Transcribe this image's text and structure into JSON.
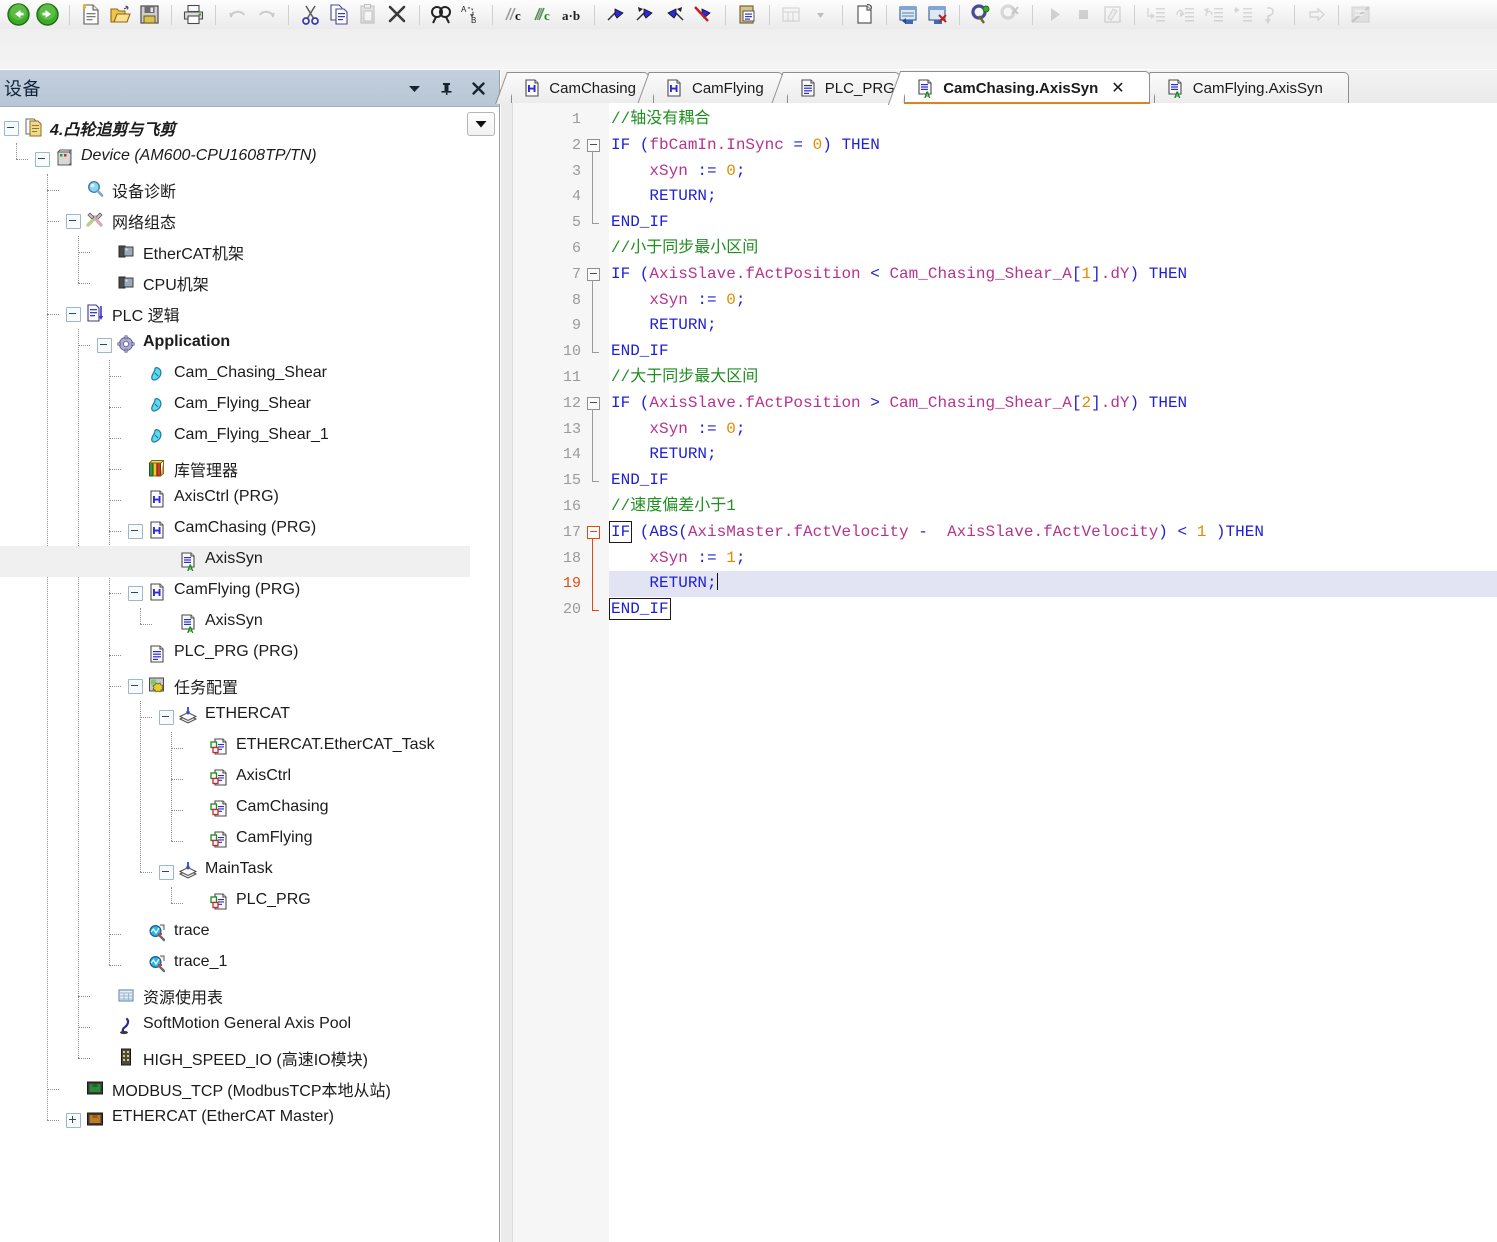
{
  "toolbar": {
    "groups": [
      {
        "items": [
          {
            "name": "back-icon",
            "label": "Back",
            "disabled": false
          },
          {
            "name": "forward-icon",
            "label": "Forward",
            "disabled": false
          }
        ]
      },
      {
        "items": [
          {
            "name": "new-file-icon",
            "label": "New",
            "disabled": false
          },
          {
            "name": "open-folder-icon",
            "label": "Open",
            "disabled": false
          },
          {
            "name": "save-icon",
            "label": "Save",
            "disabled": false
          }
        ]
      },
      {
        "items": [
          {
            "name": "print-icon",
            "label": "Print",
            "disabled": false
          }
        ]
      },
      {
        "items": [
          {
            "name": "undo-icon",
            "label": "Undo",
            "disabled": true
          },
          {
            "name": "redo-icon",
            "label": "Redo",
            "disabled": true
          }
        ]
      },
      {
        "items": [
          {
            "name": "cut-icon",
            "label": "Cut",
            "disabled": false
          },
          {
            "name": "copy-icon",
            "label": "Copy",
            "disabled": false
          },
          {
            "name": "paste-icon",
            "label": "Paste",
            "disabled": true
          },
          {
            "name": "delete-icon",
            "label": "Delete",
            "disabled": false
          }
        ]
      },
      {
        "items": [
          {
            "name": "find-icon",
            "label": "Find",
            "disabled": false
          },
          {
            "name": "replace-icon",
            "label": "Replace",
            "disabled": false
          }
        ]
      },
      {
        "items": [
          {
            "name": "comment-icon",
            "label": "Comment",
            "disabled": false
          },
          {
            "name": "uncomment-icon",
            "label": "Uncomment",
            "disabled": false
          },
          {
            "name": "text-case-icon",
            "label": "Toggle case",
            "disabled": false
          }
        ]
      },
      {
        "items": [
          {
            "name": "bookmark-toggle-icon",
            "label": "Toggle bookmark",
            "disabled": false
          },
          {
            "name": "bookmark-next-icon",
            "label": "Next bookmark",
            "disabled": false
          },
          {
            "name": "bookmark-prev-icon",
            "label": "Previous bookmark",
            "disabled": false
          },
          {
            "name": "bookmark-clear-icon",
            "label": "Clear bookmarks",
            "disabled": false
          }
        ]
      },
      {
        "items": [
          {
            "name": "properties-icon",
            "label": "Properties",
            "disabled": false
          }
        ]
      },
      {
        "items": [
          {
            "name": "insert-table-icon",
            "label": "Insert",
            "disabled": true
          },
          {
            "name": "insert-table-dropdown-icon",
            "label": "Insert options",
            "disabled": true
          }
        ]
      },
      {
        "items": [
          {
            "name": "new-page-icon",
            "label": "New page",
            "disabled": false
          }
        ]
      },
      {
        "items": [
          {
            "name": "login-icon",
            "label": "Login",
            "disabled": false
          },
          {
            "name": "logout-icon",
            "label": "Logout",
            "disabled": false
          }
        ]
      },
      {
        "items": [
          {
            "name": "build-icon",
            "label": "Build",
            "disabled": false
          },
          {
            "name": "build-clean-icon",
            "label": "Clean",
            "disabled": true
          }
        ]
      },
      {
        "items": [
          {
            "name": "run-icon",
            "label": "Start",
            "disabled": true
          },
          {
            "name": "stop-icon",
            "label": "Stop",
            "disabled": true
          },
          {
            "name": "write-values-icon",
            "label": "Write values",
            "disabled": true
          }
        ]
      },
      {
        "items": [
          {
            "name": "step-into-icon",
            "label": "Step into",
            "disabled": true
          },
          {
            "name": "step-over-icon",
            "label": "Step over",
            "disabled": true
          },
          {
            "name": "step-out-icon",
            "label": "Step out",
            "disabled": true
          },
          {
            "name": "run-to-cursor-icon",
            "label": "Run to cursor",
            "disabled": true
          },
          {
            "name": "set-next-statement-icon",
            "label": "Set next statement",
            "disabled": true
          }
        ]
      },
      {
        "items": [
          {
            "name": "next-instruction-icon",
            "label": "Next instruction",
            "disabled": true
          }
        ]
      },
      {
        "items": [
          {
            "name": "flow-control-icon",
            "label": "Flow control",
            "disabled": true
          }
        ]
      }
    ]
  },
  "devices": {
    "title": "设备",
    "header_buttons": [
      {
        "name": "panel-menu-icon",
        "glyph": "▼"
      },
      {
        "name": "pin-icon",
        "glyph": "⊥"
      },
      {
        "name": "close-icon",
        "glyph": "✕"
      }
    ],
    "dropdown_glyph": "▼",
    "tree": [
      {
        "label": "4.凸轮追剪与飞剪",
        "icon": "project-icon",
        "indent": 0,
        "toggle": "minus",
        "style": "italic-bold"
      },
      {
        "label": "Device (AM600-CPU1608TP/TN)",
        "icon": "plc-device-icon",
        "indent": 1,
        "toggle": "minus",
        "style": "italic"
      },
      {
        "label": "设备诊断",
        "icon": "diagnostics-icon",
        "indent": 2,
        "toggle": "none",
        "style": ""
      },
      {
        "label": "网络组态",
        "icon": "network-config-icon",
        "indent": 2,
        "toggle": "minus",
        "style": ""
      },
      {
        "label": "EtherCAT机架",
        "icon": "rack-icon",
        "indent": 3,
        "toggle": "none",
        "style": ""
      },
      {
        "label": "CPU机架",
        "icon": "rack-icon",
        "indent": 3,
        "toggle": "none",
        "style": ""
      },
      {
        "label": "PLC 逻辑",
        "icon": "plc-logic-icon",
        "indent": 2,
        "toggle": "minus",
        "style": ""
      },
      {
        "label": "Application",
        "icon": "application-icon",
        "indent": 3,
        "toggle": "minus",
        "style": "bold"
      },
      {
        "label": "Cam_Chasing_Shear",
        "icon": "cam-icon",
        "indent": 4,
        "toggle": "none",
        "style": ""
      },
      {
        "label": "Cam_Flying_Shear",
        "icon": "cam-icon",
        "indent": 4,
        "toggle": "none",
        "style": ""
      },
      {
        "label": "Cam_Flying_Shear_1",
        "icon": "cam-icon",
        "indent": 4,
        "toggle": "none",
        "style": ""
      },
      {
        "label": "库管理器",
        "icon": "library-manager-icon",
        "indent": 4,
        "toggle": "none",
        "style": ""
      },
      {
        "label": "AxisCtrl (PRG)",
        "icon": "prg-icon",
        "indent": 4,
        "toggle": "none",
        "style": ""
      },
      {
        "label": "CamChasing (PRG)",
        "icon": "prg-icon",
        "indent": 4,
        "toggle": "minus",
        "style": ""
      },
      {
        "label": "AxisSyn",
        "icon": "action-st-icon",
        "indent": 5,
        "toggle": "none",
        "style": "",
        "selected": true
      },
      {
        "label": "CamFlying (PRG)",
        "icon": "prg-icon",
        "indent": 4,
        "toggle": "minus",
        "style": ""
      },
      {
        "label": "AxisSyn",
        "icon": "action-st-icon",
        "indent": 5,
        "toggle": "none",
        "style": ""
      },
      {
        "label": "PLC_PRG (PRG)",
        "icon": "pou-icon",
        "indent": 4,
        "toggle": "none",
        "style": ""
      },
      {
        "label": "任务配置",
        "icon": "task-config-icon",
        "indent": 4,
        "toggle": "minus",
        "style": ""
      },
      {
        "label": "ETHERCAT",
        "icon": "task-group-icon",
        "indent": 5,
        "toggle": "minus",
        "style": ""
      },
      {
        "label": "ETHERCAT.EtherCAT_Task",
        "icon": "task-call-icon",
        "indent": 6,
        "toggle": "none",
        "style": ""
      },
      {
        "label": "AxisCtrl",
        "icon": "task-call-icon",
        "indent": 6,
        "toggle": "none",
        "style": ""
      },
      {
        "label": "CamChasing",
        "icon": "task-call-icon",
        "indent": 6,
        "toggle": "none",
        "style": ""
      },
      {
        "label": "CamFlying",
        "icon": "task-call-icon",
        "indent": 6,
        "toggle": "none",
        "style": ""
      },
      {
        "label": "MainTask",
        "icon": "task-group-icon",
        "indent": 5,
        "toggle": "minus",
        "style": ""
      },
      {
        "label": "PLC_PRG",
        "icon": "task-call-icon",
        "indent": 6,
        "toggle": "none",
        "style": ""
      },
      {
        "label": "trace",
        "icon": "trace-icon",
        "indent": 4,
        "toggle": "none",
        "style": ""
      },
      {
        "label": "trace_1",
        "icon": "trace-icon",
        "indent": 4,
        "toggle": "none",
        "style": ""
      },
      {
        "label": "资源使用表",
        "icon": "resource-table-icon",
        "indent": 3,
        "toggle": "none",
        "style": ""
      },
      {
        "label": "SoftMotion General Axis Pool",
        "icon": "axis-pool-icon",
        "indent": 3,
        "toggle": "none",
        "style": ""
      },
      {
        "label": "HIGH_SPEED_IO (高速IO模块)",
        "icon": "high-speed-io-icon",
        "indent": 3,
        "toggle": "none",
        "style": ""
      },
      {
        "label": "MODBUS_TCP (ModbusTCP本地从站)",
        "icon": "modbus-tcp-icon",
        "indent": 2,
        "toggle": "none",
        "style": ""
      },
      {
        "label": "ETHERCAT (EtherCAT Master)",
        "icon": "ethercat-master-icon",
        "indent": 2,
        "toggle": "plus",
        "style": ""
      }
    ]
  },
  "editor": {
    "tabs": [
      {
        "label": "CamChasing",
        "icon": "prg-icon",
        "active": false,
        "closable": false
      },
      {
        "label": "CamFlying",
        "icon": "prg-icon",
        "active": false,
        "closable": false
      },
      {
        "label": "PLC_PRG",
        "icon": "pou-icon",
        "active": false,
        "closable": false
      },
      {
        "label": "CamChasing.AxisSyn",
        "icon": "action-st-icon",
        "active": true,
        "closable": true,
        "close_glyph": "✕"
      },
      {
        "label": "CamFlying.AxisSyn",
        "icon": "action-st-icon",
        "active": false,
        "closable": false
      }
    ],
    "accent_color": "#e08020",
    "current_line": 19,
    "cursor_after": "RETURN;",
    "lines": [
      {
        "n": 1,
        "fold": "none",
        "tokens": [
          {
            "t": "//轴没有耦合",
            "c": "c"
          }
        ]
      },
      {
        "n": 2,
        "fold": "start",
        "tokens": [
          {
            "t": "IF",
            "c": "k"
          },
          {
            "t": " (",
            "c": "p"
          },
          {
            "t": "fbCamIn.InSync",
            "c": "id"
          },
          {
            "t": " = ",
            "c": "p"
          },
          {
            "t": "0",
            "c": "n"
          },
          {
            "t": ") ",
            "c": "p"
          },
          {
            "t": "THEN",
            "c": "k"
          }
        ]
      },
      {
        "n": 3,
        "fold": "bar",
        "tokens": [
          {
            "t": "    ",
            "c": "p"
          },
          {
            "t": "xSyn",
            "c": "id"
          },
          {
            "t": " := ",
            "c": "p"
          },
          {
            "t": "0",
            "c": "n"
          },
          {
            "t": ";",
            "c": "p"
          }
        ]
      },
      {
        "n": 4,
        "fold": "bar",
        "tokens": [
          {
            "t": "    ",
            "c": "p"
          },
          {
            "t": "RETURN;",
            "c": "k"
          }
        ]
      },
      {
        "n": 5,
        "fold": "end",
        "tokens": [
          {
            "t": "END_IF",
            "c": "k"
          }
        ]
      },
      {
        "n": 6,
        "fold": "none",
        "tokens": [
          {
            "t": "//小于同步最小区间",
            "c": "c"
          }
        ]
      },
      {
        "n": 7,
        "fold": "start",
        "tokens": [
          {
            "t": "IF",
            "c": "k"
          },
          {
            "t": " (",
            "c": "p"
          },
          {
            "t": "AxisSlave.fActPosition",
            "c": "id"
          },
          {
            "t": " < ",
            "c": "p"
          },
          {
            "t": "Cam_Chasing_Shear_A",
            "c": "id"
          },
          {
            "t": "[",
            "c": "p"
          },
          {
            "t": "1",
            "c": "n"
          },
          {
            "t": "]",
            "c": "p"
          },
          {
            "t": ".dY",
            "c": "id"
          },
          {
            "t": ") ",
            "c": "p"
          },
          {
            "t": "THEN",
            "c": "k"
          }
        ]
      },
      {
        "n": 8,
        "fold": "bar",
        "tokens": [
          {
            "t": "    ",
            "c": "p"
          },
          {
            "t": "xSyn",
            "c": "id"
          },
          {
            "t": " := ",
            "c": "p"
          },
          {
            "t": "0",
            "c": "n"
          },
          {
            "t": ";",
            "c": "p"
          }
        ]
      },
      {
        "n": 9,
        "fold": "bar",
        "tokens": [
          {
            "t": "    ",
            "c": "p"
          },
          {
            "t": "RETURN;",
            "c": "k"
          }
        ]
      },
      {
        "n": 10,
        "fold": "end",
        "tokens": [
          {
            "t": "END_IF",
            "c": "k"
          }
        ]
      },
      {
        "n": 11,
        "fold": "none",
        "tokens": [
          {
            "t": "//大于同步最大区间",
            "c": "c"
          }
        ]
      },
      {
        "n": 12,
        "fold": "start",
        "tokens": [
          {
            "t": "IF",
            "c": "k"
          },
          {
            "t": " (",
            "c": "p"
          },
          {
            "t": "AxisSlave.fActPosition",
            "c": "id"
          },
          {
            "t": " > ",
            "c": "p"
          },
          {
            "t": "Cam_Chasing_Shear_A",
            "c": "id"
          },
          {
            "t": "[",
            "c": "p"
          },
          {
            "t": "2",
            "c": "n"
          },
          {
            "t": "]",
            "c": "p"
          },
          {
            "t": ".dY",
            "c": "id"
          },
          {
            "t": ") ",
            "c": "p"
          },
          {
            "t": "THEN",
            "c": "k"
          }
        ]
      },
      {
        "n": 13,
        "fold": "bar",
        "tokens": [
          {
            "t": "    ",
            "c": "p"
          },
          {
            "t": "xSyn",
            "c": "id"
          },
          {
            "t": " := ",
            "c": "p"
          },
          {
            "t": "0",
            "c": "n"
          },
          {
            "t": ";",
            "c": "p"
          }
        ]
      },
      {
        "n": 14,
        "fold": "bar",
        "tokens": [
          {
            "t": "    ",
            "c": "p"
          },
          {
            "t": "RETURN;",
            "c": "k"
          }
        ]
      },
      {
        "n": 15,
        "fold": "end",
        "tokens": [
          {
            "t": "END_IF",
            "c": "k"
          }
        ]
      },
      {
        "n": 16,
        "fold": "none",
        "tokens": [
          {
            "t": "//速度偏差小于1",
            "c": "c"
          }
        ]
      },
      {
        "n": 17,
        "fold": "start-active",
        "tokens": [
          {
            "t": "IF",
            "c": "k",
            "box": true
          },
          {
            "t": " (ABS(",
            "c": "p"
          },
          {
            "t": "AxisMaster.fActVelocity",
            "c": "id"
          },
          {
            "t": " -  ",
            "c": "p"
          },
          {
            "t": "AxisSlave.fActVelocity",
            "c": "id"
          },
          {
            "t": ") < ",
            "c": "p"
          },
          {
            "t": "1",
            "c": "n"
          },
          {
            "t": " )",
            "c": "p"
          },
          {
            "t": "THEN",
            "c": "k"
          }
        ]
      },
      {
        "n": 18,
        "fold": "bar-active",
        "tokens": [
          {
            "t": "    ",
            "c": "p"
          },
          {
            "t": "xSyn",
            "c": "id"
          },
          {
            "t": " := ",
            "c": "p"
          },
          {
            "t": "1",
            "c": "n"
          },
          {
            "t": ";",
            "c": "p"
          }
        ]
      },
      {
        "n": 19,
        "fold": "bar-active",
        "current": true,
        "tokens": [
          {
            "t": "    ",
            "c": "p"
          },
          {
            "t": "RETURN;",
            "c": "k"
          }
        ]
      },
      {
        "n": 20,
        "fold": "end-active",
        "tokens": [
          {
            "t": "END_IF",
            "c": "k",
            "box": true
          }
        ]
      }
    ],
    "colors": {
      "keyword": "#1f1fd6",
      "comment": "#1f8f20",
      "number": "#e08a00",
      "identifier": "#b5338f",
      "current_line_bg": "#e2e4f4",
      "active_fold": "#e24a12"
    }
  }
}
